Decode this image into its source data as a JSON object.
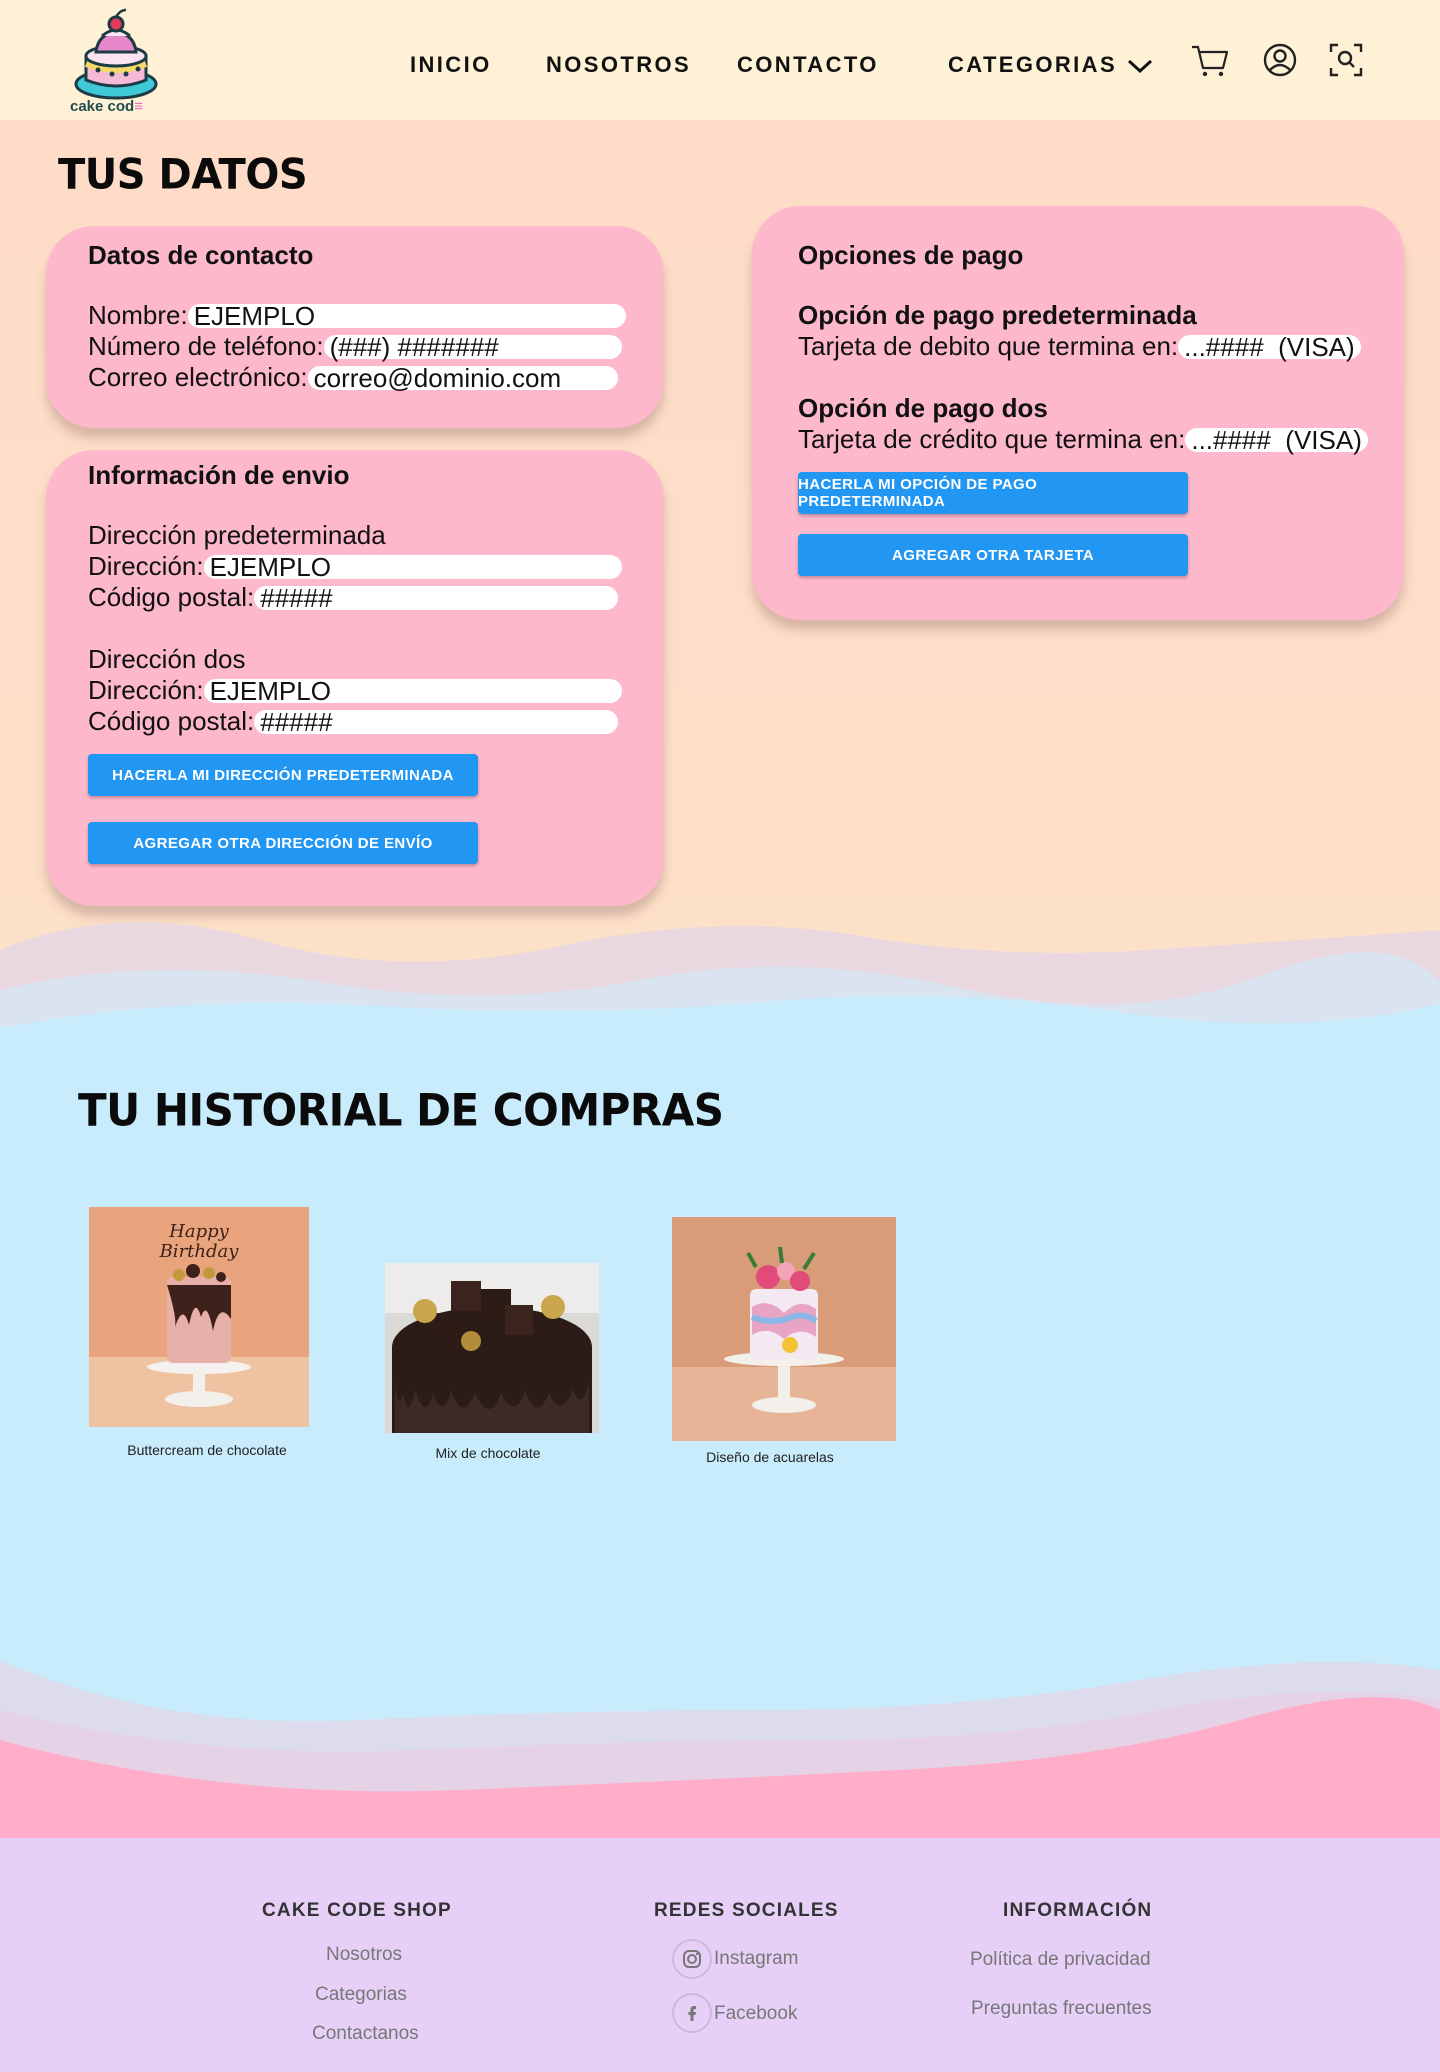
{
  "brand": {
    "logo_text": "cake cod",
    "logo_suffix": "≡"
  },
  "nav": {
    "inicio": "INICIO",
    "nosotros": "NOSOTROS",
    "contacto": "CONTACTO",
    "categorias": "CATEGORIAS",
    "icons": [
      "cart-icon",
      "user-icon",
      "search-icon"
    ]
  },
  "datos": {
    "title": "TUS DATOS",
    "contact": {
      "title": "Datos de contacto",
      "name_label": "Nombre:",
      "name_value": "EJEMPLO",
      "phone_label": "Número de teléfono:",
      "phone_value": "(###) #######",
      "email_label": "Correo electrónico:",
      "email_value": "correo@dominio.com"
    },
    "shipping": {
      "title": "Información de envio",
      "addr1_title": "Dirección predeterminada",
      "addr1_label": "Dirección:",
      "addr1_value": "EJEMPLO",
      "zip1_label": "Código postal:",
      "zip1_value": "#####",
      "addr2_title": "Dirección dos",
      "addr2_label": "Dirección:",
      "addr2_value": "EJEMPLO",
      "zip2_label": "Código postal:",
      "zip2_value": "#####",
      "btn_default": "HACERLA MI DIRECCIÓN PREDETERMINADA",
      "btn_add": "AGREGAR OTRA DIRECCIÓN DE ENVÍO"
    },
    "payment": {
      "title": "Opciones de pago",
      "opt1_title": "Opción de pago predeterminada",
      "opt1_label": "Tarjeta de debito que termina en:",
      "opt1_value": "...####  (VISA)",
      "opt2_title": "Opción de pago dos",
      "opt2_label": "Tarjeta de crédito que termina en:",
      "opt2_value": "...####  (VISA)",
      "btn_default": "HACERLA MI OPCIÓN DE PAGO PREDETERMINADA",
      "btn_add": "AGREGAR OTRA TARJETA"
    }
  },
  "history": {
    "title": "TU HISTORIAL DE COMPRAS",
    "items": [
      {
        "caption": "Buttercream de chocolate",
        "topper": "Happy Birthday"
      },
      {
        "caption": "Mix de chocolate"
      },
      {
        "caption": "Diseño de acuarelas"
      }
    ]
  },
  "footer": {
    "shop_title": "CAKE CODE SHOP",
    "shop_links": [
      "Nosotros",
      "Categorias",
      "Contactanos"
    ],
    "social_title": "REDES SOCIALES",
    "social_links": [
      "Instagram",
      "Facebook"
    ],
    "info_title": "INFORMACIÓN",
    "info_links": [
      "Política de privacidad",
      "Preguntas frecuentes"
    ]
  },
  "colors": {
    "header_bg": "#fef1d6",
    "top_bg": "#fedcc8",
    "card_bg": "#feb8cc",
    "button": "#2196f3",
    "mid_bg": "#c9ecfd",
    "wave_pink": "#ffadc8",
    "footer_bg": "#e6d0f7"
  }
}
